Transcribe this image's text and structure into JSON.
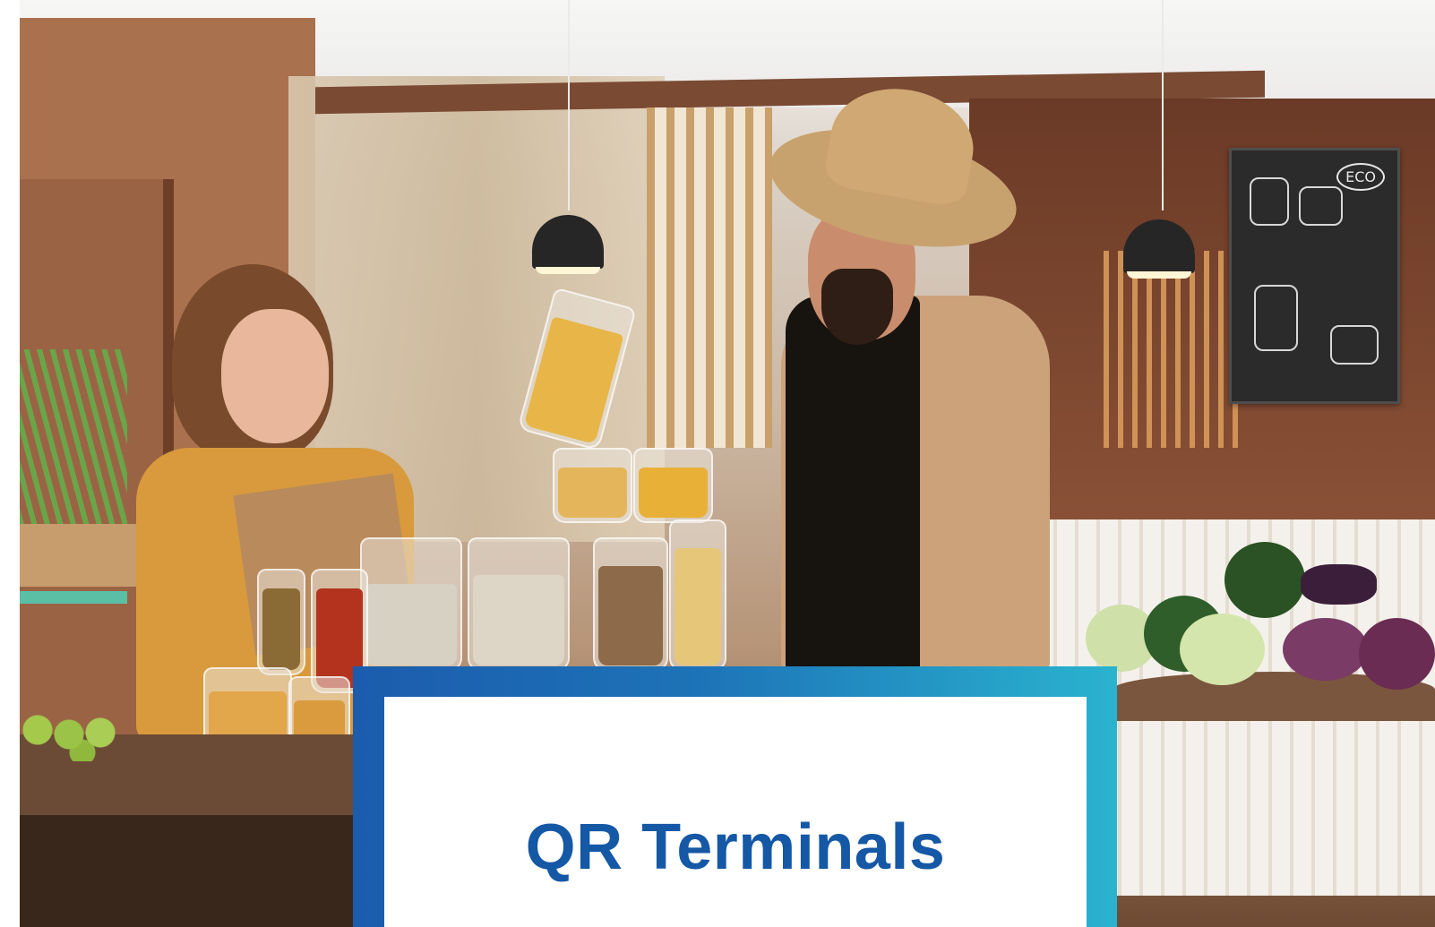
{
  "hero": {
    "chalkboard_text": "ECO"
  },
  "card": {
    "title": "QR Terminals"
  },
  "colors": {
    "title": "#1558a5",
    "frame_start": "#1b5cad",
    "frame_end": "#2ab3cf",
    "card_background": "#ffffff"
  }
}
